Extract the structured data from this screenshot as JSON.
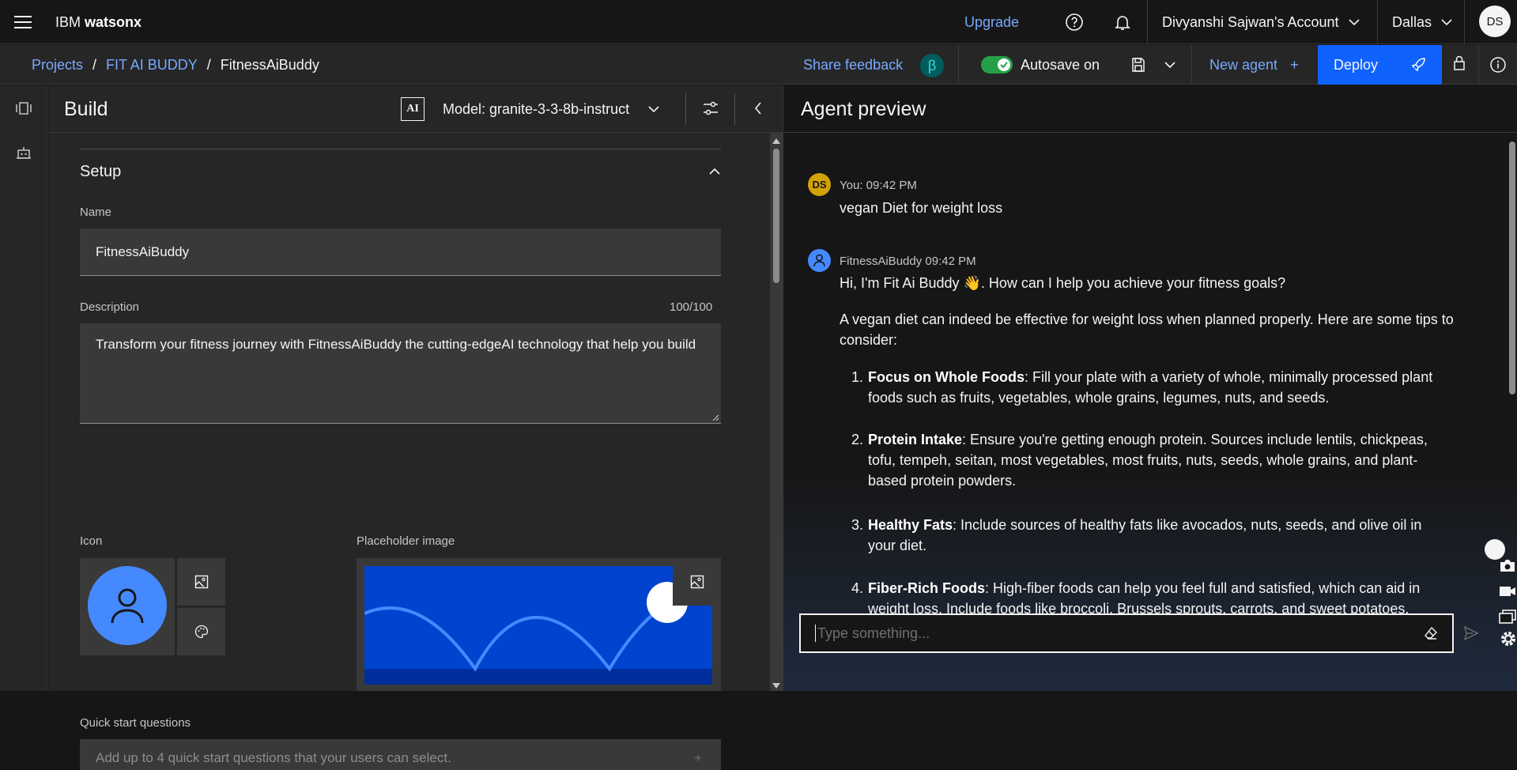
{
  "header": {
    "brand_prefix": "IBM",
    "brand_product": "watsonx",
    "upgrade": "Upgrade",
    "account": "Divyanshi Sajwan's Account",
    "region": "Dallas",
    "avatar": "DS"
  },
  "breadcrumb": {
    "items": [
      "Projects",
      "FIT AI BUDDY",
      "FitnessAiBuddy"
    ],
    "separator": "/"
  },
  "toolbar": {
    "share_feedback": "Share feedback",
    "beta": "β",
    "autosave": "Autosave on",
    "new_agent": "New agent",
    "new_agent_plus": "+",
    "deploy": "Deploy"
  },
  "build": {
    "title": "Build",
    "ai_badge": "AI",
    "model": "Model: granite-3-3-8b-instruct",
    "section_title": "Setup",
    "name_label": "Name",
    "name_value": "FitnessAiBuddy",
    "description_label": "Description",
    "description_count": "100/100",
    "description_value": "Transform your fitness journey with FitnessAiBuddy the cutting-edgeAI technology that help you build",
    "icon_label": "Icon",
    "placeholder_label": "Placeholder image",
    "quick_label": "Quick start questions",
    "quick_placeholder": "Add up to 4 quick start questions that your users can select.",
    "quick_plus": "+"
  },
  "preview": {
    "title": "Agent preview",
    "user_initials": "DS",
    "user_meta": "You: 09:42 PM",
    "user_message": "vegan Diet for weight loss",
    "agent_meta": "FitnessAiBuddy 09:42 PM",
    "greeting": "Hi, I'm Fit Ai Buddy 👋. How can I help you achieve your fitness goals?",
    "intro": "A vegan diet can indeed be effective for weight loss when planned properly. Here are some tips to consider:",
    "tips": [
      {
        "num": "1.",
        "title": "Focus on Whole Foods",
        "text": ": Fill your plate with a variety of whole, minimally processed plant foods such as fruits, vegetables, whole grains, legumes, nuts, and seeds."
      },
      {
        "num": "2.",
        "title": "Protein Intake",
        "text": ": Ensure you're getting enough protein. Sources include lentils, chickpeas, tofu, tempeh, seitan, most vegetables, most fruits, nuts, seeds, whole grains, and plant-based protein powders."
      },
      {
        "num": "3.",
        "title": "Healthy Fats",
        "text": ": Include sources of healthy fats like avocados, nuts, seeds, and olive oil in your diet."
      },
      {
        "num": "4.",
        "title": "Fiber-Rich Foods",
        "text": ": High-fiber foods can help you feel full and satisfied, which can aid in weight loss. Include foods like broccoli, Brussels sprouts, carrots, and sweet potatoes."
      }
    ],
    "input_placeholder": "Type something..."
  },
  "colors": {
    "accent": "#0f62fe",
    "link": "#78a9ff",
    "toggle": "#24a148",
    "avatar_user": "#d2a106",
    "avatar_agent": "#4589ff"
  }
}
